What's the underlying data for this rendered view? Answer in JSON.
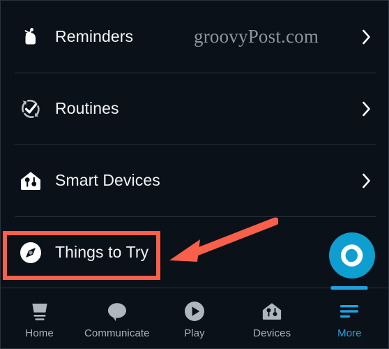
{
  "app": {
    "background_color": "#0a1119",
    "accent_color": "#1ba3e0",
    "annotation_color": "#f8604a",
    "watermark": "groovyPost.com"
  },
  "menu": {
    "rows": [
      {
        "label": "Reminders",
        "icon": "reminder-hand-icon",
        "chevron": "chevron-right-icon"
      },
      {
        "label": "Routines",
        "icon": "routines-loop-icon",
        "chevron": "chevron-right-icon"
      },
      {
        "label": "Smart Devices",
        "icon": "smart-home-icon",
        "chevron": "chevron-right-icon"
      },
      {
        "label": "Things to Try",
        "icon": "compass-icon",
        "chevron": ""
      }
    ]
  },
  "alexa": {
    "button_label": "Alexa",
    "icon": "alexa-ring-icon"
  },
  "annotations": {
    "highlight_target": "Things to Try",
    "arrow": "red-arrow-left"
  },
  "bottom_nav": {
    "items": [
      {
        "label": "Home",
        "icon": "echo-device-icon",
        "active": false
      },
      {
        "label": "Communicate",
        "icon": "speech-bubble-icon",
        "active": false
      },
      {
        "label": "Play",
        "icon": "play-circle-icon",
        "active": false
      },
      {
        "label": "Devices",
        "icon": "smart-home-icon",
        "active": false
      },
      {
        "label": "More",
        "icon": "hamburger-menu-icon",
        "active": true
      }
    ]
  }
}
